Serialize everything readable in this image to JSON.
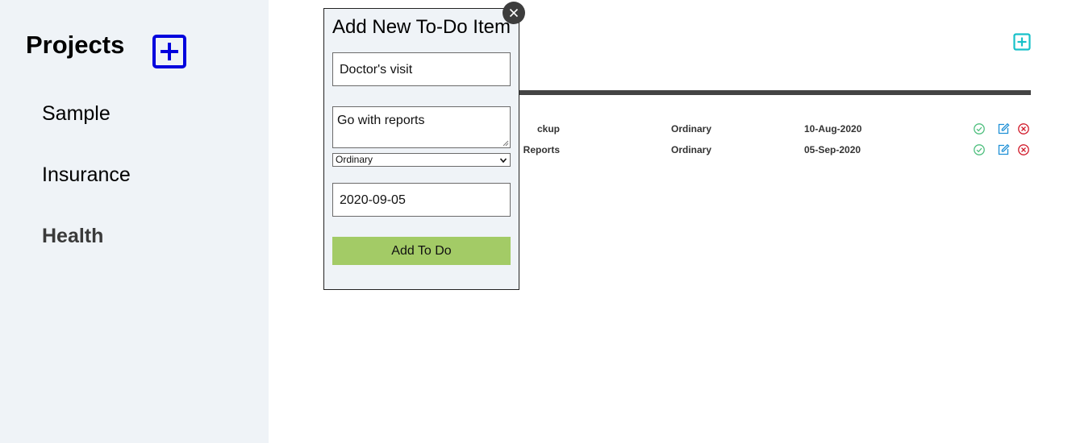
{
  "sidebar": {
    "title": "Projects",
    "projects": [
      {
        "label": "Sample"
      },
      {
        "label": "Insurance"
      },
      {
        "label": "Health"
      }
    ]
  },
  "main": {
    "todos": [
      {
        "title": "ckup",
        "priority": "Ordinary",
        "date": "10-Aug-2020"
      },
      {
        "title": "Reports",
        "priority": "Ordinary",
        "date": "05-Sep-2020"
      }
    ]
  },
  "modal": {
    "title": "Add New To-Do Item",
    "title_value": "Doctor's visit",
    "description_value": "Go with reports",
    "priority_selected": "Ordinary",
    "date_value": "2020-09-05",
    "submit_label": "Add To Do"
  },
  "colors": {
    "sidebar_bg": "#eff3f7",
    "project_add_blue": "#0000dd",
    "todo_add_teal": "#17c1c9",
    "done_green": "#4fbf7e",
    "edit_blue": "#1e90d6",
    "delete_red": "#d11a2a",
    "submit_green": "#a3cb66"
  }
}
